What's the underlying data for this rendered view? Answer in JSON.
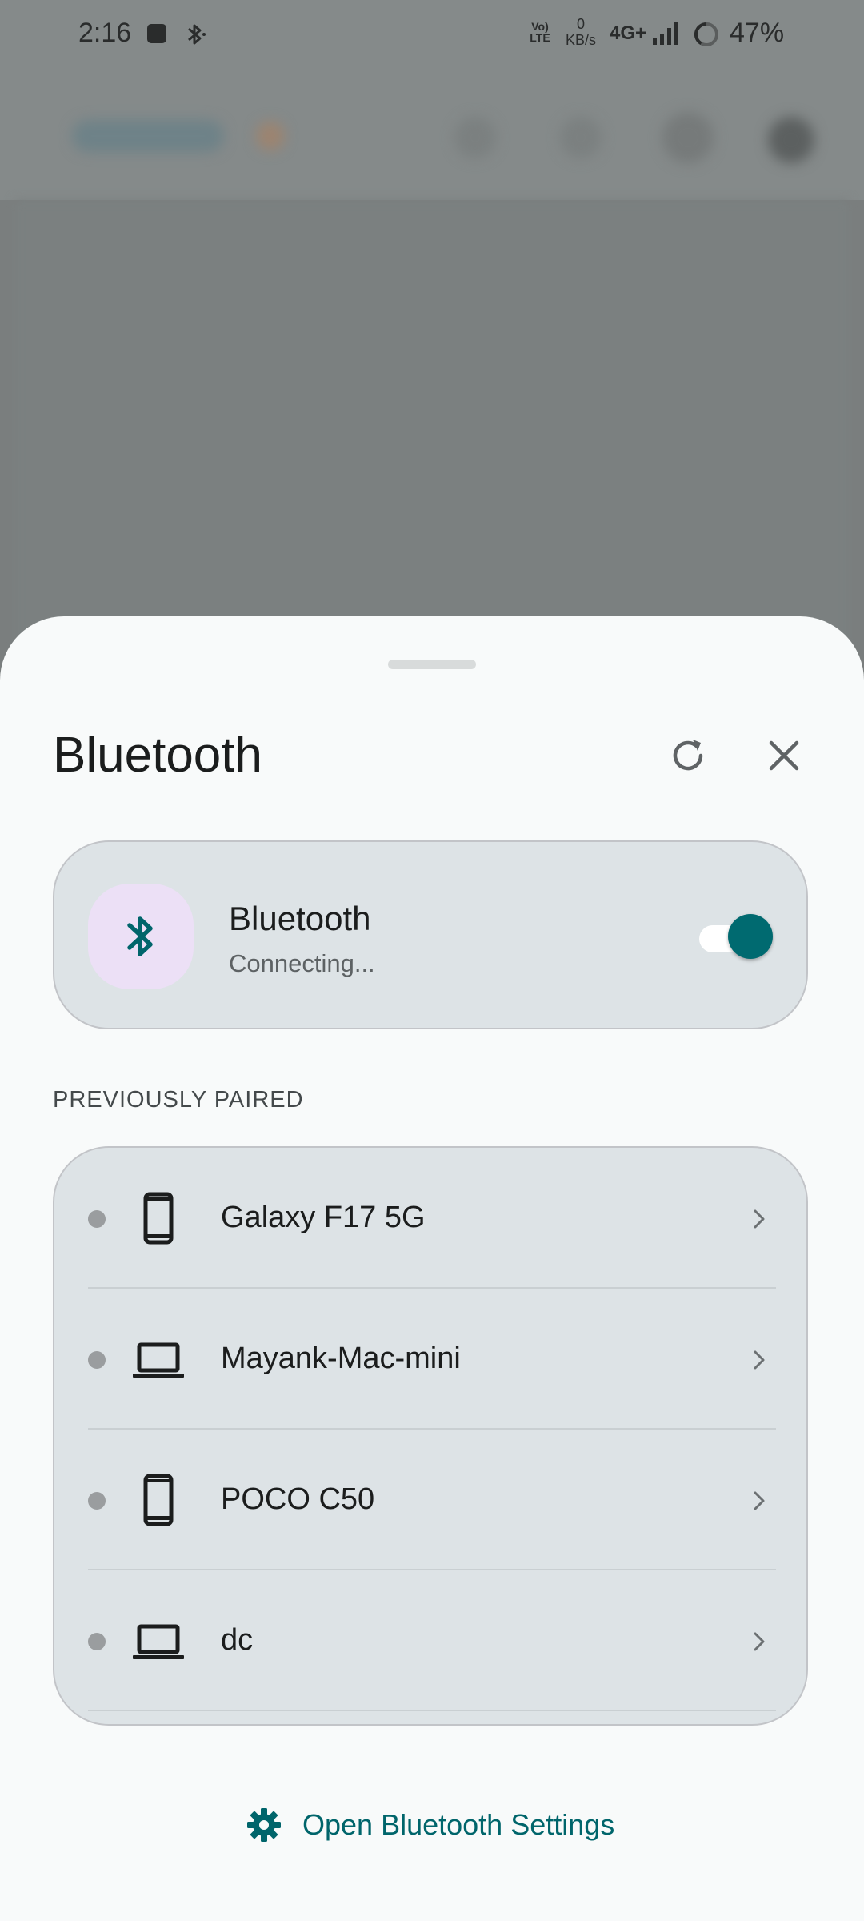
{
  "status_bar": {
    "time": "2:16",
    "volte": "Vo) LTE",
    "speed_value": "0",
    "speed_unit": "KB/s",
    "network": "4G+",
    "battery": "47%"
  },
  "sheet": {
    "title": "Bluetooth",
    "refresh_icon": "refresh-icon",
    "close_icon": "close-icon"
  },
  "bluetooth_card": {
    "title": "Bluetooth",
    "status": "Connecting...",
    "icon": "bluetooth-icon",
    "enabled": true
  },
  "paired_section": {
    "label": "PREVIOUSLY PAIRED",
    "devices": [
      {
        "name": "Galaxy F17 5G",
        "type": "phone"
      },
      {
        "name": "Mayank-Mac-mini",
        "type": "laptop"
      },
      {
        "name": "POCO C50",
        "type": "phone"
      },
      {
        "name": "dc",
        "type": "laptop"
      }
    ]
  },
  "footer": {
    "open_settings_label": "Open Bluetooth Settings",
    "icon": "gear-icon"
  },
  "colors": {
    "accent": "#006a70",
    "card_bg": "#dde3e6",
    "sheet_bg": "#f8fafa",
    "bt_icon_bg": "#ece0f6"
  }
}
